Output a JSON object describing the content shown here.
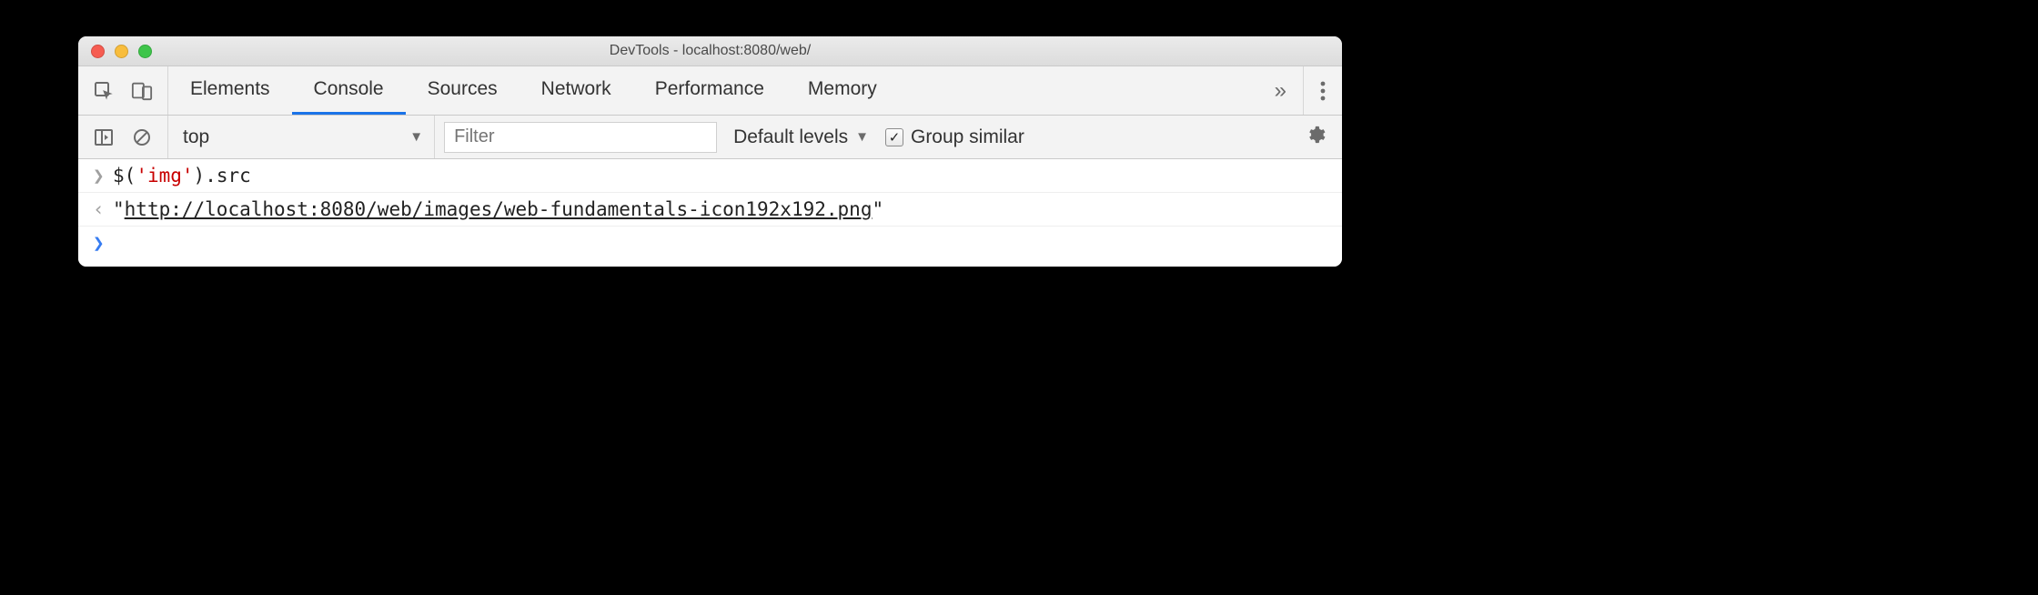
{
  "titlebar": {
    "title": "DevTools - localhost:8080/web/"
  },
  "main_toolbar": {
    "tabs": [
      {
        "label": "Elements",
        "active": false
      },
      {
        "label": "Console",
        "active": true
      },
      {
        "label": "Sources",
        "active": false
      },
      {
        "label": "Network",
        "active": false
      },
      {
        "label": "Performance",
        "active": false
      },
      {
        "label": "Memory",
        "active": false
      }
    ],
    "overflow_glyph": "»"
  },
  "sub_toolbar": {
    "context": {
      "selected": "top"
    },
    "filter": {
      "placeholder": "Filter",
      "value": ""
    },
    "levels": {
      "label": "Default levels"
    },
    "group_similar": {
      "label": "Group similar",
      "checked": true
    }
  },
  "console": {
    "input_prompt_glyph": "❯",
    "result_prompt_glyph": "‹",
    "active_prompt_glyph": "❯",
    "input": {
      "fn": "$",
      "open": "(",
      "arg_str": "'img'",
      "close": ")",
      "dot": ".",
      "prop": "src"
    },
    "result": {
      "open_quote": "\"",
      "url": "http://localhost:8080/web/images/web-fundamentals-icon192x192.png",
      "close_quote": "\""
    }
  }
}
